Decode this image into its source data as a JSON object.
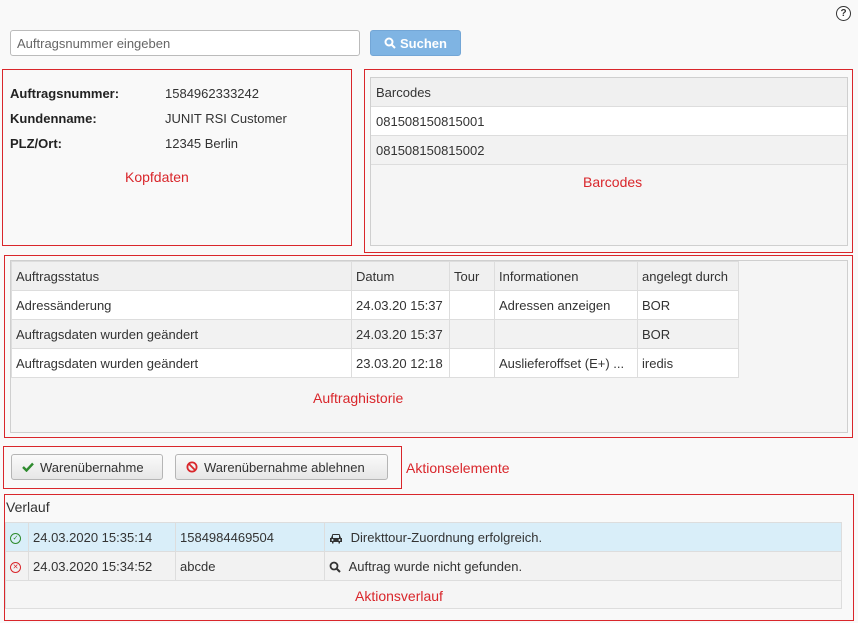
{
  "search": {
    "placeholder": "Auftragsnummer eingeben",
    "button_label": "Suchen"
  },
  "kopfdaten": {
    "rows": [
      {
        "label": "Auftragsnummer:",
        "value": "1584962333242"
      },
      {
        "label": "Kundenname:",
        "value": "JUNIT RSI Customer"
      },
      {
        "label": "PLZ/Ort:",
        "value": "12345 Berlin"
      }
    ],
    "annotation": "Kopfdaten"
  },
  "barcodes": {
    "header": "Barcodes",
    "items": [
      "081508150815001",
      "081508150815002"
    ],
    "annotation": "Barcodes"
  },
  "historie": {
    "columns": [
      "Auftragsstatus",
      "Datum",
      "Tour",
      "Informationen",
      "angelegt durch"
    ],
    "rows": [
      [
        "Adressänderung",
        "24.03.20 15:37",
        "",
        "Adressen anzeigen",
        "BOR"
      ],
      [
        "Auftragsdaten wurden geändert",
        "24.03.20 15:37",
        "",
        "",
        "BOR"
      ],
      [
        "Auftragsdaten wurden geändert",
        "23.03.20 12:18",
        "",
        "Auslieferoffset (E+) ...",
        "iredis"
      ]
    ],
    "annotation": "Auftraghistorie"
  },
  "aktionen": {
    "accept_label": "Warenübernahme",
    "reject_label": "Warenübernahme ablehnen",
    "annotation": "Aktionselemente"
  },
  "verlauf": {
    "title": "Verlauf",
    "rows": [
      {
        "status": "success",
        "time": "24.03.2020 15:35:14",
        "id": "1584984469504",
        "icon": "car-icon",
        "message": "Direkttour-Zuordnung erfolgreich."
      },
      {
        "status": "error",
        "time": "24.03.2020 15:34:52",
        "id": "abcde",
        "icon": "search-icon",
        "message": "Auftrag wurde nicht gefunden."
      }
    ],
    "annotation": "Aktionsverlauf"
  },
  "colors": {
    "annotation_red": "#d9262b",
    "primary_button": "#7fb4e3",
    "highlight_row": "#d9eef9",
    "success": "#2e8b2e",
    "error": "#d9262b"
  }
}
